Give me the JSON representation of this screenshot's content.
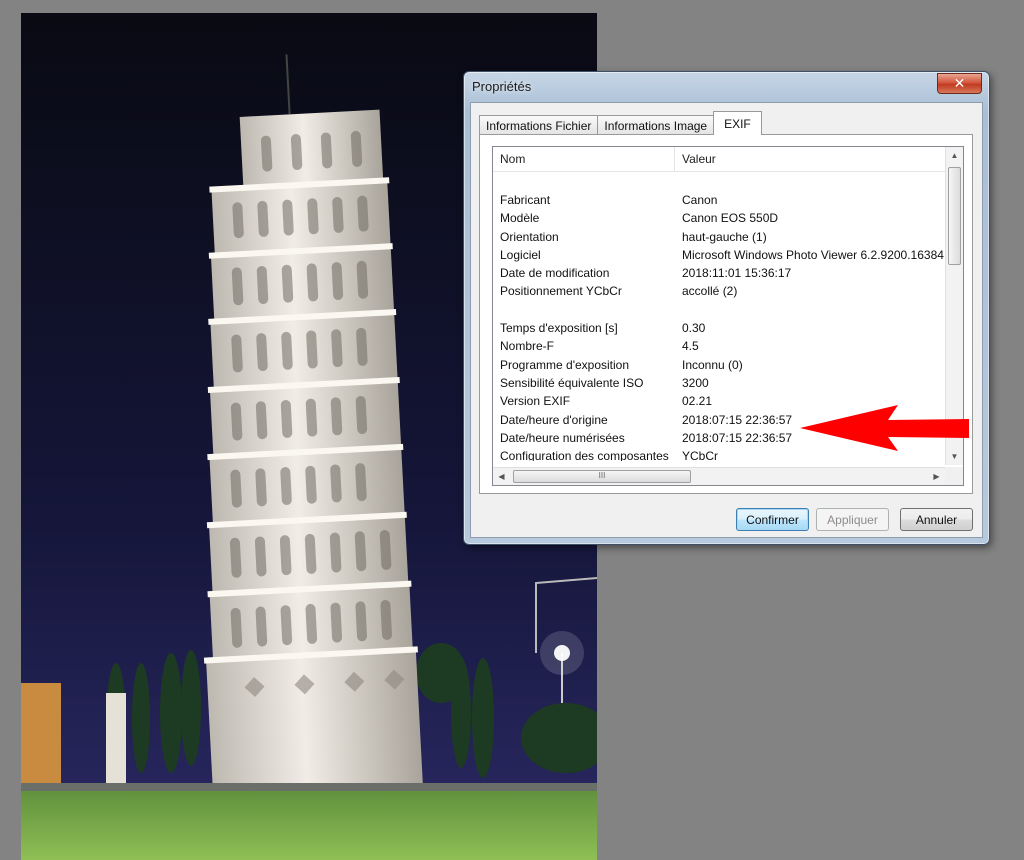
{
  "dialog": {
    "title": "Propriétés",
    "close_glyph": "✕",
    "tabs": [
      {
        "label": "Informations Fichier"
      },
      {
        "label": "Informations Image"
      },
      {
        "label": "EXIF"
      }
    ],
    "active_tab": "EXIF",
    "list": {
      "columns": {
        "name": "Nom",
        "value": "Valeur"
      },
      "rows": [
        {
          "name": "",
          "value": ""
        },
        {
          "name": "Fabricant",
          "value": "Canon"
        },
        {
          "name": "Modèle",
          "value": "Canon EOS 550D"
        },
        {
          "name": "Orientation",
          "value": "haut-gauche (1)"
        },
        {
          "name": "Logiciel",
          "value": "Microsoft Windows Photo Viewer 6.2.9200.16384"
        },
        {
          "name": "Date de modification",
          "value": "2018:11:01 15:36:17"
        },
        {
          "name": "Positionnement YCbCr",
          "value": "accollé (2)"
        },
        {
          "name": "",
          "value": ""
        },
        {
          "name": "Temps d'exposition [s]",
          "value": "0.30"
        },
        {
          "name": "Nombre-F",
          "value": "4.5"
        },
        {
          "name": "Programme d'exposition",
          "value": "Inconnu (0)"
        },
        {
          "name": "Sensibilité équivalente ISO",
          "value": "3200"
        },
        {
          "name": "Version EXIF",
          "value": "02.21"
        },
        {
          "name": "Date/heure d'origine",
          "value": "2018:07:15 22:36:57"
        },
        {
          "name": "Date/heure numérisées",
          "value": "2018:07:15 22:36:57"
        },
        {
          "name": "Configuration des composantes",
          "value": "YCbCr"
        }
      ]
    },
    "hscroll_grip": "III",
    "buttons": {
      "confirm": "Confirmer",
      "apply": "Appliquer",
      "cancel": "Annuler"
    }
  },
  "annotation": {
    "arrow_color": "#ff0000",
    "icon": "arrow-left-icon"
  }
}
